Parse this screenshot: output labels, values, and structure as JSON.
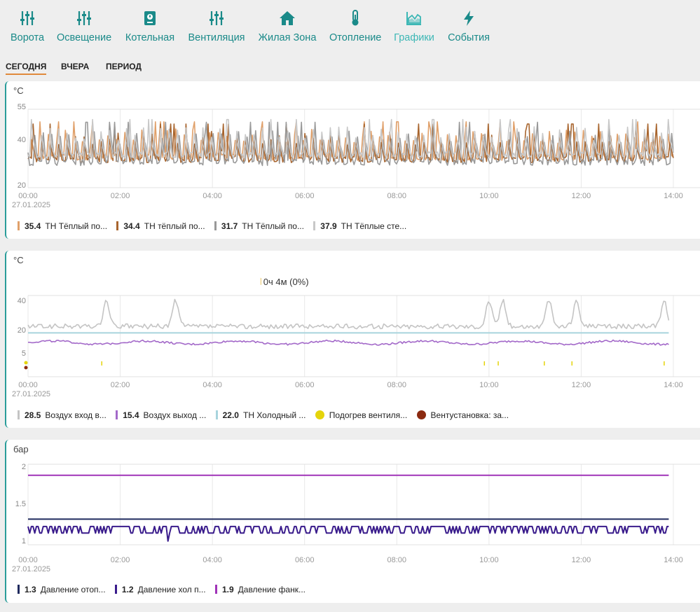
{
  "nav": [
    {
      "label": "Ворота",
      "icon": "sliders-icon"
    },
    {
      "label": "Освещение",
      "icon": "sliders-icon"
    },
    {
      "label": "Котельная",
      "icon": "boiler-icon"
    },
    {
      "label": "Вентиляция",
      "icon": "sliders-icon"
    },
    {
      "label": "Жилая Зона",
      "icon": "home-icon"
    },
    {
      "label": "Отопление",
      "icon": "thermometer-icon"
    },
    {
      "label": "Графики",
      "icon": "area-chart-icon",
      "active": true
    },
    {
      "label": "События",
      "icon": "lightning-icon"
    }
  ],
  "tabs": [
    {
      "label": "СЕГОДНЯ",
      "active": true
    },
    {
      "label": "ВЧЕРА"
    },
    {
      "label": "ПЕРИОД"
    }
  ],
  "colors": {
    "accent": "#1a8a89",
    "accent_active": "#3cb7b5",
    "tab_underline": "#e08a3c"
  },
  "chart_data": [
    {
      "type": "line",
      "unit": "°C",
      "ylim": [
        20,
        55
      ],
      "yticks": [
        "55",
        "40",
        "20"
      ],
      "date_label": "27.01.2025",
      "xticks": [
        "00:00",
        "02:00",
        "04:00",
        "06:00",
        "08:00",
        "10:00",
        "12:00",
        "14:00"
      ],
      "grid": true,
      "series": [
        {
          "name": "ТН Тёплый по...",
          "value": "35.4",
          "color": "#e0a06a",
          "shape": "spiky",
          "base": 35,
          "amp": 8,
          "seed": 3
        },
        {
          "name": "ТН тёплый по...",
          "value": "34.4",
          "color": "#a8652e",
          "shape": "spiky",
          "base": 34,
          "amp": 8,
          "seed": 7
        },
        {
          "name": "ТН Тёплый по...",
          "value": "31.7",
          "color": "#999999",
          "shape": "spiky",
          "base": 33,
          "amp": 9,
          "seed": 11
        },
        {
          "name": "ТН Тёплые сте...",
          "value": "37.9",
          "color": "#c8c8c8",
          "shape": "spiky",
          "base": 36,
          "amp": 8,
          "seed": 17
        }
      ]
    },
    {
      "type": "line",
      "unit": "°C",
      "annotation": "0ч 4м (0%)",
      "ylim": [
        -5,
        45
      ],
      "yticks": [
        "40",
        "20",
        "5"
      ],
      "date_label": "27.01.2025",
      "xticks": [
        "00:00",
        "02:00",
        "04:00",
        "06:00",
        "08:00",
        "10:00",
        "12:00",
        "14:00"
      ],
      "grid": true,
      "series": [
        {
          "name": "Воздух вход в...",
          "value": "28.5",
          "color": "#c4c4c4",
          "shape": "peaks",
          "base": 26,
          "peaks": [
            1.7,
            3.2,
            10.0,
            10.3,
            11.3,
            11.9,
            13.8
          ]
        },
        {
          "name": "Воздух выход ...",
          "value": "15.4",
          "color": "#a369c9",
          "shape": "flat-noise",
          "base": 16
        },
        {
          "name": "ТН Холодный ...",
          "value": "22.0",
          "color": "#a8d4dd",
          "shape": "flat",
          "base": 22
        }
      ],
      "events": [
        {
          "name": "Подогрев вентиля...",
          "color": "#e5d40b",
          "times": [
            1.6,
            9.9,
            10.2,
            11.2,
            11.8,
            13.8
          ]
        },
        {
          "name": "Вентустановка: за...",
          "color": "#8b2a10",
          "times": [
            0.0
          ]
        }
      ]
    },
    {
      "type": "line",
      "unit": "бар",
      "ylim": [
        0.95,
        2.05
      ],
      "yticks": [
        "2",
        "1.5",
        "1"
      ],
      "date_label": "27.01.2025",
      "xticks": [
        "00:00",
        "02:00",
        "04:00",
        "06:00",
        "08:00",
        "10:00",
        "12:00",
        "14:00"
      ],
      "grid": true,
      "series": [
        {
          "name": "Давление отоп...",
          "value": "1.3",
          "color": "#1f2a5e",
          "shape": "flat",
          "base": 1.3
        },
        {
          "name": "Давление хол п...",
          "value": "1.2",
          "color": "#3a1c8c",
          "shape": "pulses",
          "base": 1.2
        },
        {
          "name": "Давление фанк...",
          "value": "1.9",
          "color": "#a033b8",
          "shape": "flat",
          "base": 1.9
        }
      ]
    }
  ]
}
